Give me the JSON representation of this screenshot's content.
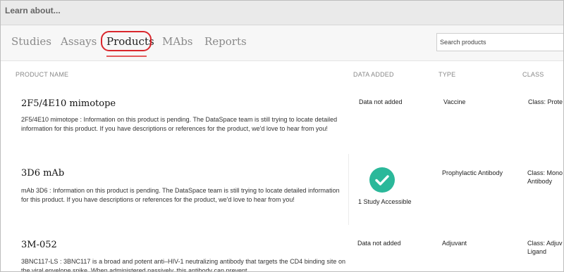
{
  "header": {
    "title": "Learn about..."
  },
  "tabs": [
    {
      "label": "Studies",
      "active": false
    },
    {
      "label": "Assays",
      "active": false
    },
    {
      "label": "Products",
      "active": true
    },
    {
      "label": "MAbs",
      "active": false
    },
    {
      "label": "Reports",
      "active": false
    }
  ],
  "search": {
    "placeholder": "Search products",
    "value": ""
  },
  "columns": {
    "product_name": "PRODUCT NAME",
    "data_added": "DATA ADDED",
    "type": "TYPE",
    "class": "CLASS"
  },
  "products": [
    {
      "name": "2F5/4E10 mimotope",
      "description": "2F5/4E10 mimotope : Information on this product is pending. The DataSpace team is still trying to locate detailed information for this product. If you have descriptions or references for the product, we'd love to hear from you!",
      "data_added": "Data not added",
      "type": "Vaccine",
      "class": "Class: Prote"
    },
    {
      "name": "3D6 mAb",
      "description": "mAb 3D6 : Information on this product is pending. The DataSpace team is still trying to locate detailed information for this product. If you have descriptions or references for the product, we'd love to hear from you!",
      "data_added": "1 Study Accessible",
      "type": "Prophylactic Antibody",
      "class": "Class: Mono Antibody"
    },
    {
      "name": "3M-052",
      "description": "3BNC117-LS : 3BNC117 is a broad and potent anti–HIV-1 neutralizing antibody that targets the CD4 binding site on the viral envelope spike. When administered passively, this antibody can prevent",
      "data_added": "Data not added",
      "type": "Adjuvant",
      "class": "Class: Adjuv Ligand"
    }
  ],
  "colors": {
    "accent": "#d9262c",
    "check": "#2bb89a"
  }
}
